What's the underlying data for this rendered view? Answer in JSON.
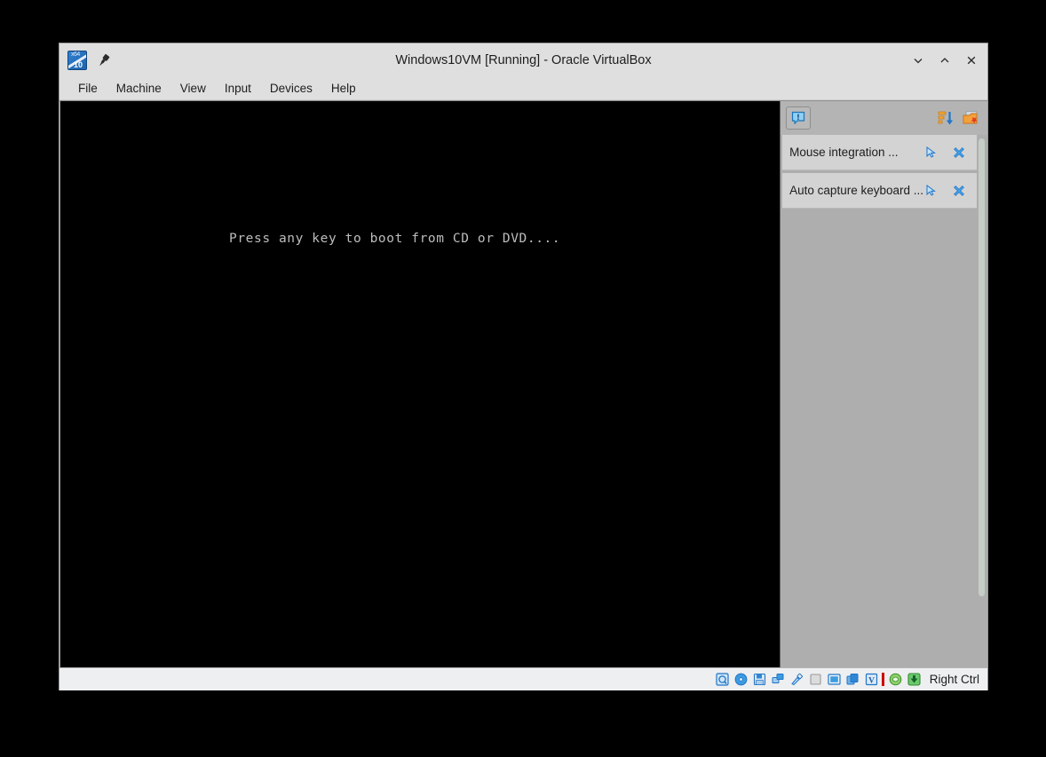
{
  "window": {
    "title": "Windows10VM [Running] - Oracle VirtualBox",
    "vm_icon_top_label": "x64",
    "vm_icon_bottom_label": "10",
    "pin_icon": "pin-icon",
    "controls": [
      {
        "name": "minimize-button",
        "icon": "chevron-down-icon"
      },
      {
        "name": "maximize-button",
        "icon": "chevron-up-icon"
      },
      {
        "name": "close-button",
        "icon": "close-icon"
      }
    ]
  },
  "menubar": {
    "items": [
      {
        "label": "File"
      },
      {
        "label": "Machine"
      },
      {
        "label": "View"
      },
      {
        "label": "Input"
      },
      {
        "label": "Devices"
      },
      {
        "label": "Help"
      }
    ]
  },
  "vm_screen": {
    "boot_message": "Press any key to boot from CD or DVD....",
    "background_color": "#000000",
    "text_color": "#bdbdbd"
  },
  "notification_center": {
    "tab_icon": "notification-bubble-icon",
    "toolbar_icons": [
      {
        "name": "sort-descending-icon"
      },
      {
        "name": "remove-finished-icon"
      }
    ],
    "items": [
      {
        "label": "Mouse integration ...",
        "cursor_icon": "mouse-pointer-icon",
        "close_icon": "dismiss-icon"
      },
      {
        "label": "Auto capture keyboard ...",
        "cursor_icon": "mouse-pointer-icon",
        "close_icon": "dismiss-icon"
      }
    ]
  },
  "statusbar": {
    "indicators": [
      {
        "name": "hard-disk-icon"
      },
      {
        "name": "optical-disk-icon"
      },
      {
        "name": "floppy-disk-icon"
      },
      {
        "name": "network-icon"
      },
      {
        "name": "usb-icon"
      },
      {
        "name": "shared-folders-icon"
      },
      {
        "name": "display-icon"
      },
      {
        "name": "recording-icon"
      },
      {
        "name": "virtualbox-logo-icon"
      },
      {
        "name": "mouse-capture-icon"
      },
      {
        "name": "host-key-icon"
      }
    ],
    "host_key": "Right Ctrl"
  },
  "colors": {
    "window_chrome": "#dfdfdf",
    "vm_screen": "#000000",
    "notification_panel": "#aeaeae",
    "notification_item": "#d3d3d3",
    "statusbar": "#eeeff0",
    "accent_blue": "#2f7fd0"
  }
}
